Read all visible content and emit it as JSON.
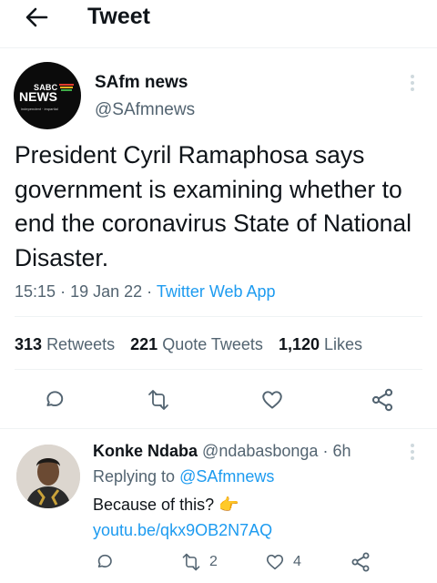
{
  "header": {
    "title": "Tweet"
  },
  "tweet": {
    "avatar_logo_top": "SABC",
    "avatar_logo_main": "NEWS",
    "avatar_logo_tagline": "independent · impartial",
    "author_name": "SAfm news",
    "author_handle": "@SAfmnews",
    "text": "President Cyril Ramaphosa says government is examining whether to end the coronavirus State of National Disaster.",
    "time": "15:15",
    "date": "19 Jan 22",
    "source": "Twitter Web App",
    "stats": {
      "retweets_count": "313",
      "retweets_label": "Retweets",
      "quotes_count": "221",
      "quotes_label": "Quote Tweets",
      "likes_count": "1,120",
      "likes_label": "Likes"
    },
    "actions": [
      "reply-icon",
      "retweet-icon",
      "like-icon",
      "share-icon"
    ]
  },
  "reply": {
    "author_name": "Konke Ndaba",
    "author_handle": "@ndabasbonga",
    "time": "6h",
    "replying_label": "Replying to",
    "replying_to": "@SAfmnews",
    "text": "Because of this?",
    "emoji": "👉",
    "link": "youtu.be/qkx9OB2N7AQ",
    "retweet_count": "2",
    "like_count": "4"
  },
  "colors": {
    "accent": "#1d9bf0",
    "secondary_text": "#536471",
    "text": "#0f1419"
  }
}
